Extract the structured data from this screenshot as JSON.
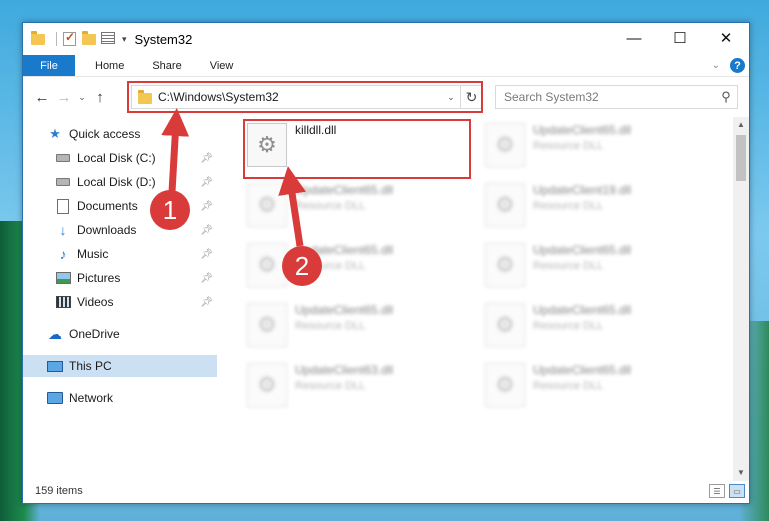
{
  "window": {
    "title": "System32"
  },
  "window_controls": {
    "minimize": "—",
    "maximize": "☐",
    "close": "✕"
  },
  "ribbon": {
    "file_tab": "File",
    "tabs": [
      "Home",
      "Share",
      "View"
    ],
    "help": "?"
  },
  "address": {
    "path": "C:\\Windows\\System32",
    "dropdown": "⌄",
    "refresh": "↻"
  },
  "search": {
    "placeholder": "Search System32"
  },
  "sidebar": {
    "items": [
      {
        "label": "Quick access",
        "icon": "star-icon",
        "pinned": false
      },
      {
        "label": "Local Disk (C:)",
        "icon": "disk-icon",
        "pinned": true
      },
      {
        "label": "Local Disk (D:)",
        "icon": "disk-icon",
        "pinned": true
      },
      {
        "label": "Documents",
        "icon": "documents-icon",
        "pinned": true
      },
      {
        "label": "Downloads",
        "icon": "download-icon",
        "pinned": true
      },
      {
        "label": "Music",
        "icon": "music-icon",
        "pinned": true
      },
      {
        "label": "Pictures",
        "icon": "pictures-icon",
        "pinned": true
      },
      {
        "label": "Videos",
        "icon": "videos-icon",
        "pinned": true
      },
      {
        "label": "OneDrive",
        "icon": "cloud-icon",
        "pinned": false
      },
      {
        "label": "This PC",
        "icon": "computer-icon",
        "pinned": false,
        "selected": true
      },
      {
        "label": "Network",
        "icon": "network-icon",
        "pinned": false
      }
    ]
  },
  "files": [
    {
      "name": "killdll.dll",
      "type": ""
    },
    {
      "name": "UpdateClient65.dll",
      "type": "Resource DLL"
    },
    {
      "name": "UpdateClient65.dll",
      "type": "Resource DLL"
    },
    {
      "name": "UpdateClient19.dll",
      "type": "Resource DLL"
    },
    {
      "name": "UpdateClient65.dll",
      "type": "Resource DLL"
    },
    {
      "name": "UpdateClient65.dll",
      "type": "Resource DLL"
    },
    {
      "name": "UpdateClient65.dll",
      "type": "Resource DLL"
    },
    {
      "name": "UpdateClient65.dll",
      "type": "Resource DLL"
    },
    {
      "name": "UpdateClient63.dll",
      "type": "Resource DLL"
    },
    {
      "name": "UpdateClient65.dll",
      "type": "Resource DLL"
    }
  ],
  "status": {
    "item_count": "159 items"
  },
  "annotations": {
    "step1": "1",
    "step2": "2",
    "color": "#d93b3b"
  }
}
